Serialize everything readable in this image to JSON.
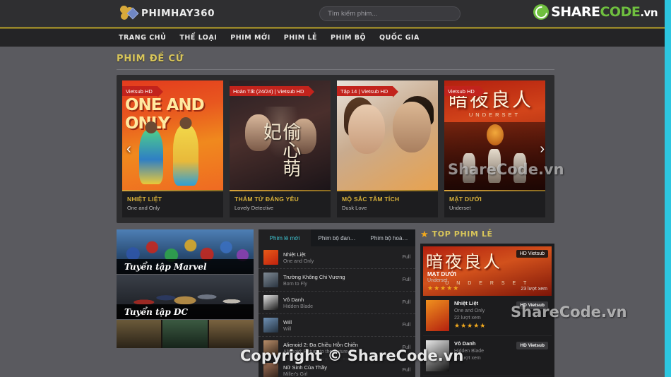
{
  "header": {
    "brand": "PHIMHAY360",
    "brand_icon": "film-reel-icon",
    "search_placeholder": "Tìm kiếm phim...",
    "search_value": "",
    "sharecode": {
      "part1": "SHARE",
      "part2": "CODE",
      "part3": ".vn",
      "icon": "sharecode-logo-icon",
      "color": "#6fbf3f"
    }
  },
  "nav": {
    "items": [
      {
        "label": "TRANG CHỦ"
      },
      {
        "label": "THỂ LOẠI"
      },
      {
        "label": "PHIM MỚI"
      },
      {
        "label": "PHIM LẺ"
      },
      {
        "label": "PHIM BỘ"
      },
      {
        "label": "QUỐC GIA"
      }
    ]
  },
  "featured": {
    "title": "PHIM ĐỀ CỬ",
    "prev_icon": "chevron-left-icon",
    "next_icon": "chevron-right-icon",
    "cards": [
      {
        "badge": "Vietsub HD",
        "title": "NHIỆT LIỆT",
        "subtitle": "One and Only"
      },
      {
        "badge": "Hoàn Tất (24/24) | Vietsub HD",
        "title": "THÁM TỬ ĐÁNG YÊU",
        "subtitle": "Lovely Detective",
        "hanzi": "偷心萌妃"
      },
      {
        "badge": "Tập 14 | Vietsub HD",
        "title": "MỘ SẮC TÂM TÍCH",
        "subtitle": "Dusk Love"
      },
      {
        "badge": "Vietsub HD",
        "title": "MẶT DƯỚI",
        "subtitle": "Underset",
        "hanzi": "暗夜良人",
        "latin": "UNDERSET"
      }
    ]
  },
  "collections": [
    {
      "label": "Tuyển tập Marvel"
    },
    {
      "label": "Tuyển tập DC"
    }
  ],
  "list": {
    "tabs": [
      {
        "label": "Phim lẻ mới",
        "active": true
      },
      {
        "label": "Phim bộ đan…",
        "active": false
      },
      {
        "label": "Phim bộ hoà…",
        "active": false
      }
    ],
    "items": [
      {
        "title": "Nhiệt Liệt",
        "subtitle": "One and Only",
        "status": "Full"
      },
      {
        "title": "Trường Không Chi Vương",
        "subtitle": "Born to Fly",
        "status": "Full"
      },
      {
        "title": "Vô Danh",
        "subtitle": "Hidden Blade",
        "status": "Full"
      },
      {
        "title": "Will",
        "subtitle": "Will",
        "status": "Full"
      },
      {
        "title": "Alienoid 2: Đa Chiều Hỗn Chiến",
        "subtitle": "Alienoid: Return to the Future",
        "status": "Full"
      },
      {
        "title": "Nữ Sinh Của Thầy",
        "subtitle": "Miller's Girl",
        "status": "Full"
      }
    ]
  },
  "top": {
    "title": "TOP PHIM LẺ",
    "star_icon": "star-icon",
    "hero": {
      "title": "MẠT DƯỚI",
      "subtitle": "Underset",
      "tag": "HD Vietsub",
      "views": "23 lượt xem",
      "stars": "★★★★★",
      "hanzi": "暗夜良人",
      "latin": "U N D E R S E T"
    },
    "rows": [
      {
        "title": "Nhiệt Liệt",
        "subtitle": "One and Only",
        "views": "22 lượt xem",
        "tag": "HD Vietsub",
        "stars": "★★★★★"
      },
      {
        "title": "Vô Danh",
        "subtitle": "Hidden Blade",
        "views": "21 lượt xem",
        "tag": "HD Vietsub",
        "stars": ""
      }
    ]
  },
  "watermarks": {
    "w1": "ShareCode.vn",
    "w2": "ShareCode.vn",
    "w3": "Copyright © ShareCode.vn"
  }
}
